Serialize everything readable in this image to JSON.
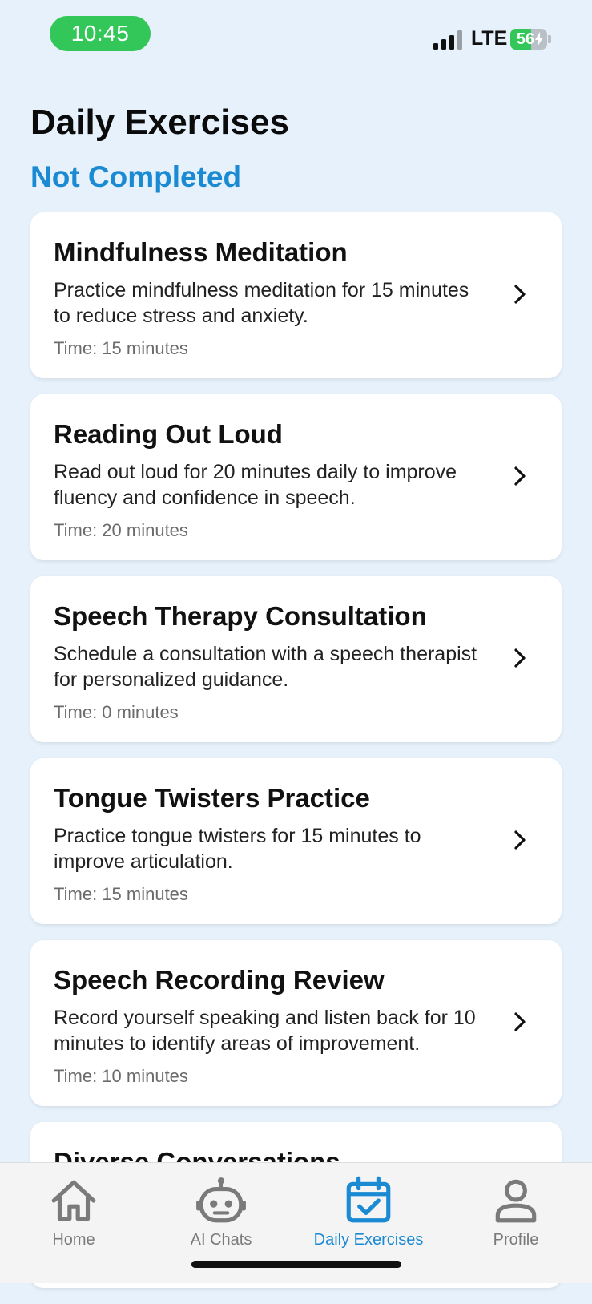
{
  "status_bar": {
    "time": "10:45",
    "network": "LTE",
    "battery": "56",
    "battery_level_percent": 56,
    "colors": {
      "time_pill": "#33c759",
      "battery_fill": "#33c759"
    }
  },
  "header": {
    "title": "Daily Exercises",
    "section": "Not Completed"
  },
  "exercises": [
    {
      "title": "Mindfulness Meditation",
      "description": "Practice mindfulness meditation for 15 minutes to reduce stress and anxiety.",
      "time": "Time: 15 minutes"
    },
    {
      "title": "Reading Out Loud",
      "description": "Read out loud for 20 minutes daily to improve fluency and confidence in speech.",
      "time": "Time: 20 minutes"
    },
    {
      "title": "Speech Therapy Consultation",
      "description": "Schedule a consultation with a speech therapist for personalized guidance.",
      "time": "Time: 0 minutes"
    },
    {
      "title": "Tongue Twisters Practice",
      "description": "Practice tongue twisters for 15 minutes to improve articulation.",
      "time": "Time: 15 minutes"
    },
    {
      "title": "Speech Recording Review",
      "description": "Record yourself speaking and listen back for 10 minutes to identify areas of improvement.",
      "time": "Time: 10 minutes"
    },
    {
      "title": "Diverse Conversations",
      "description": "",
      "time": ""
    }
  ],
  "tab_bar": {
    "tabs": [
      {
        "label": "Home",
        "icon": "home-icon",
        "active": false
      },
      {
        "label": "AI Chats",
        "icon": "robot-icon",
        "active": false
      },
      {
        "label": "Daily Exercises",
        "icon": "calendar-check-icon",
        "active": true
      },
      {
        "label": "Profile",
        "icon": "person-icon",
        "active": false
      }
    ]
  },
  "colors": {
    "background": "#e6f1fb",
    "accent": "#1a8ad3",
    "tab_inactive": "#7a7a7a"
  }
}
